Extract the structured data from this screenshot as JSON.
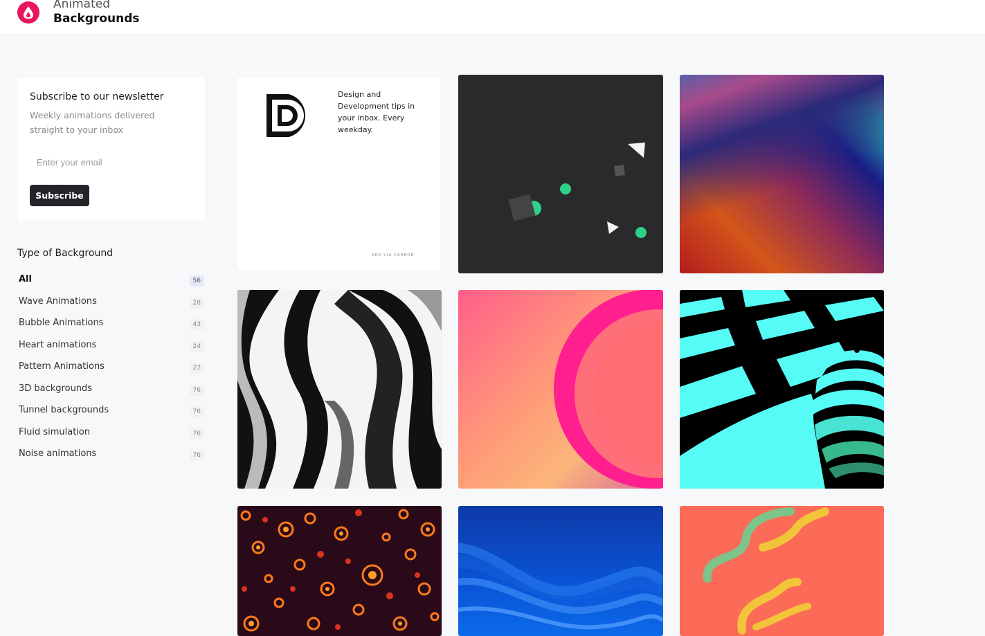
{
  "brand": {
    "line1": "Animated",
    "line2": "Backgrounds",
    "logo_icon": "flame-drop-icon",
    "accent": "#e8175d"
  },
  "newsletter": {
    "title": "Subscribe to our newsletter",
    "subtitle": "Weekly animations delivered straight to your inbox",
    "email_placeholder": "Enter your email",
    "button_label": "Subscribe"
  },
  "filters": {
    "title": "Type of Background",
    "items": [
      {
        "label": "All",
        "count": "56",
        "active": true
      },
      {
        "label": "Wave Animations",
        "count": "28"
      },
      {
        "label": "Bubble Animations",
        "count": "43"
      },
      {
        "label": "Heart animations",
        "count": "24"
      },
      {
        "label": "Pattern Animations",
        "count": "27"
      },
      {
        "label": "3D backgrounds",
        "count": "76"
      },
      {
        "label": "Tunnel backgrounds",
        "count": "76"
      },
      {
        "label": "Fluid simulation",
        "count": "76"
      },
      {
        "label": "Noise animations",
        "count": "76"
      }
    ]
  },
  "ad": {
    "text": "Design and Development tips in your inbox. Every weekday.",
    "footer": "ADS VIA CARBON"
  },
  "gallery": [
    {
      "name": "floating-shapes-dark",
      "color": "#2a2a2c"
    },
    {
      "name": "gradient-blur",
      "color": "#1a1d85"
    },
    {
      "name": "liquid-marble",
      "color": "#f2f2f2"
    },
    {
      "name": "pink-circle",
      "color": "#ff9a78"
    },
    {
      "name": "cyan-checker-sphere",
      "color": "#55f5f0"
    },
    {
      "name": "fire-flowers",
      "color": "#2a0a18"
    },
    {
      "name": "blue-waves",
      "color": "#0a54d6"
    },
    {
      "name": "coral-squiggles",
      "color": "#fb6b58"
    }
  ]
}
